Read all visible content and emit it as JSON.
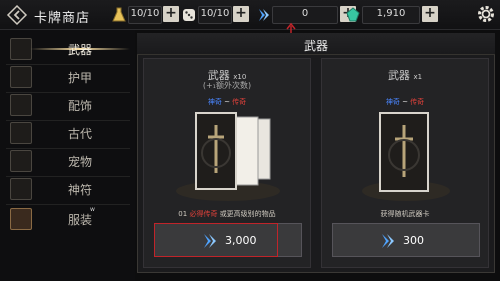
{
  "header": {
    "title": "卡牌商店",
    "resources": [
      {
        "name": "energy",
        "value": "10/10",
        "icon": "flask-icon"
      },
      {
        "name": "dice",
        "value": "10/10",
        "icon": "dice-icon"
      },
      {
        "name": "blue-gem",
        "value": "0",
        "icon": "blue-crystal-icon"
      },
      {
        "name": "green-gem",
        "value": "1,910",
        "icon": "green-crystal-icon"
      }
    ]
  },
  "sidebar": {
    "items": [
      {
        "label": "武器",
        "active": true
      },
      {
        "label": "护甲"
      },
      {
        "label": "配饰"
      },
      {
        "label": "古代"
      },
      {
        "label": "宠物"
      },
      {
        "label": "神符"
      },
      {
        "label": "服装"
      }
    ],
    "marker_w": "w"
  },
  "panel": {
    "title": "武器",
    "cards": [
      {
        "title": "武器",
        "mult": "x10",
        "subtitle": "(+₁额外次数)",
        "rarity_a": "神奇",
        "rarity_sep": "~",
        "rarity_b": "传奇",
        "note_num": "01",
        "note_red": "必得传奇",
        "note_rest": "或更高级别的物品",
        "price": "3,000"
      },
      {
        "title": "武器",
        "mult": "x1",
        "subtitle": "",
        "rarity_a": "神奇",
        "rarity_sep": "~",
        "rarity_b": "传奇",
        "note": "获得随机武器卡",
        "price": "300"
      }
    ]
  },
  "colors": {
    "accent_gold": "#ffe4a8",
    "rarity_blue": "#4a86ff",
    "rarity_red": "#e0413a",
    "highlight_red": "#c0242a"
  }
}
